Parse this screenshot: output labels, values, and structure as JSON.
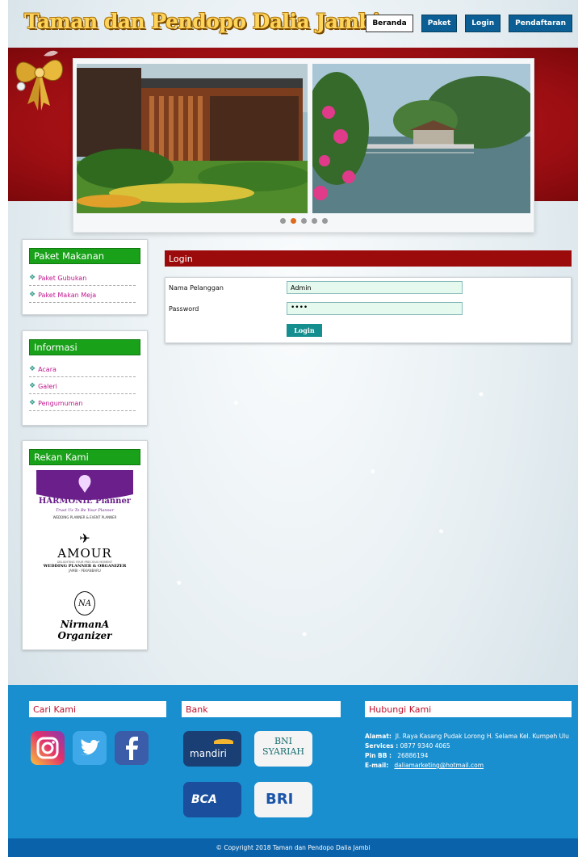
{
  "header": {
    "site_title": "Taman dan Pendopo Dalia Jambi",
    "nav": [
      {
        "label": "Beranda"
      },
      {
        "label": "Paket"
      },
      {
        "label": "Login"
      },
      {
        "label": "Pendaftaran"
      }
    ]
  },
  "sidebar": {
    "paket": {
      "title": "Paket Makanan",
      "items": [
        "Paket Gubukan",
        "Paket Makan Meja"
      ]
    },
    "informasi": {
      "title": "Informasi",
      "items": [
        "Acara",
        "Galeri",
        "Pengumuman"
      ]
    },
    "rekan": {
      "title": "Rekan Kami",
      "partners": {
        "harmonie": {
          "name": "HARMONIE Planner",
          "tagline": "Trust Us To Be Your Planner",
          "sub": "WEDDING PLANNER & EVENT PLANNER"
        },
        "amour": {
          "name": "AMOUR",
          "tagline": "DELIGHTING YOUR PRECIOUS MOMENT",
          "sub": "WEDDING PLANNER & ORGANIZER",
          "city": "JAMBI - PEKANBARU"
        },
        "nirmana": {
          "monogram": "NA",
          "name": "NirmanA Organizer"
        }
      }
    }
  },
  "login": {
    "title": "Login",
    "username_label": "Nama Pelanggan",
    "username_value": "Admin",
    "password_label": "Password",
    "password_value": "••••",
    "submit_label": "Login"
  },
  "footer": {
    "cari_title": "Cari Kami",
    "bank_title": "Bank",
    "hubungi_title": "Hubungi Kami",
    "banks": [
      "mandiri",
      "BNI SYARIAH",
      "BCA",
      "BRI"
    ],
    "contact": {
      "alamat_label": "Alamat:",
      "alamat_value": "Jl. Raya Kasang Pudak Lorong H. Selama Kel. Kumpeh Ulu",
      "services_label": "Services :",
      "services_value": "0877 9340 4065",
      "pinbb_label": "Pin BB :",
      "pinbb_value": "26886194",
      "email_label": "E-mail:",
      "email_value": "daliamarketing@hotmail.com"
    },
    "copyright": "© Copyright 2018 Taman dan Pendopo Dalia Jambi"
  },
  "colors": {
    "nav_dark": "#0c5f94",
    "sidebar_head": "#19a119",
    "login_head": "#9c0b0b",
    "footer_bg": "#1a8fcf",
    "copyright_bg": "#0a63aa",
    "menu_link": "#c0168e"
  },
  "slider": {
    "active_dot": 2,
    "dot_count": 5
  }
}
